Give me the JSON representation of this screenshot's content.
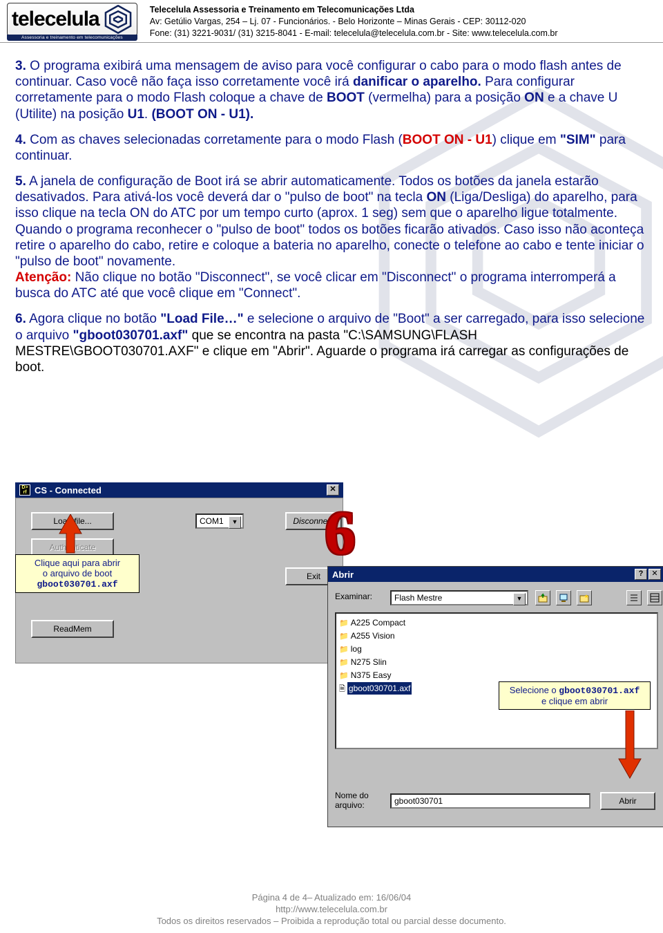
{
  "header": {
    "logo_text": "telecelula",
    "tagline": "Assessoria e treinamento em telecomunicações",
    "line1": "Telecelula Assessoria e Treinamento em Telecomunicações Ltda",
    "line2": "Av: Getúlio Vargas, 254 – Lj. 07 - Funcionários. - Belo Horizonte – Minas Gerais - CEP: 30112-020",
    "line3": "Fone: (31) 3221-9031/ (31) 3215-8041 - E-mail: telecelula@telecelula.com.br - Site: www.telecelula.com.br"
  },
  "paragraphs": {
    "p3_num": "3.",
    "p3_a": " O programa exibirá uma mensagem de aviso para você configurar o cabo para o modo flash antes de continuar. Caso você não faça isso corretamente você irá ",
    "p3_danificar": "danificar o aparelho.",
    "p3_b": " Para configurar corretamente para o modo Flash coloque a chave de ",
    "p3_boot": "BOOT",
    "p3_c": " (vermelha) para a posição ",
    "p3_on": "ON",
    "p3_d": " e a chave U (Utilite) na posição ",
    "p3_u1": "U1",
    "p3_e": ". ",
    "p3_bootonu1": "(BOOT ON - U1).",
    "p4_num": "4.",
    "p4_a": " Com as chaves selecionadas corretamente para o modo Flash (",
    "p4_boot": "BOOT ON - U1",
    "p4_b": ") clique em ",
    "p4_sim": "\"SIM\"",
    "p4_c": " para continuar.",
    "p5_num": "5.",
    "p5_a": " A janela de configuração de Boot irá se abrir automaticamente. Todos os botões da janela estarão desativados. Para ativá-los você deverá dar o \"pulso de boot\" na tecla ",
    "p5_on": "ON",
    "p5_b": " (Liga/Desliga) do aparelho, para isso clique na tecla ON do ATC por um tempo curto (aprox. 1 seg) sem que o aparelho ligue totalmente. Quando o programa reconhecer o \"pulso de boot\" todos os botões ficarão ativados. Caso isso não aconteça retire o aparelho do cabo, retire e coloque a bateria no aparelho, conecte o telefone ao cabo e tente iniciar o \"pulso de boot\" novamente.",
    "p5_atencao": "Atenção:",
    "p5_c": " Não clique no botão \"Disconnect\", se você clicar em \"Disconnect\" o programa interromperá a busca do ATC até que você clique em \"Connect\".",
    "p6_num": "6.",
    "p6_a": " Agora clique no botão ",
    "p6_load": "\"Load File…\"",
    "p6_b": " e selecione o arquivo de \"Boot\" a ser carregado, para isso selecione o arquivo ",
    "p6_file": "\"gboot030701.axf\"",
    "p6_c": " que se encontra na pasta \"C:\\SAMSUNG\\FLASH MESTRE\\GBOOT030701.AXF\" e clique em \"Abrir\". Aguarde o programa irá carregar as configurações de boot."
  },
  "app_window": {
    "title": "CS  - Connected",
    "btn_load": "Load file...",
    "btn_auth": "Authenticate",
    "btn_readmem": "ReadMem",
    "combo_port": "COM1",
    "btn_disconnect": "Disconnect",
    "btn_exit": "Exit"
  },
  "callout1": {
    "line1": "Clique aqui para abrir",
    "line2": "o arquivo de boot",
    "line3": "gboot030701.axf"
  },
  "big6": "6",
  "dialog": {
    "title": "Abrir",
    "label_examinar": "Examinar:",
    "combo_folder": "Flash Mestre",
    "files": [
      {
        "type": "folder",
        "name": "A225 Compact"
      },
      {
        "type": "folder",
        "name": "A255 Vision"
      },
      {
        "type": "folder",
        "name": "log"
      },
      {
        "type": "folder",
        "name": "N275 Slin"
      },
      {
        "type": "folder",
        "name": "N375 Easy"
      },
      {
        "type": "file",
        "name": "gboot030701.axf",
        "selected": true
      }
    ],
    "label_nome": "Nome do arquivo:",
    "input_nome": "gboot030701",
    "btn_abrir": "Abrir"
  },
  "callout2": {
    "line1": "Selecione o ",
    "file": "gboot030701.axf",
    "line2": "e clique em abrir"
  },
  "footer": {
    "line1": "Página 4 de 4– Atualizado em: 16/06/04",
    "line2": "http://www.telecelula.com.br",
    "line3": "Todos os direitos reservados – Proibida a reprodução total ou parcial desse documento."
  }
}
